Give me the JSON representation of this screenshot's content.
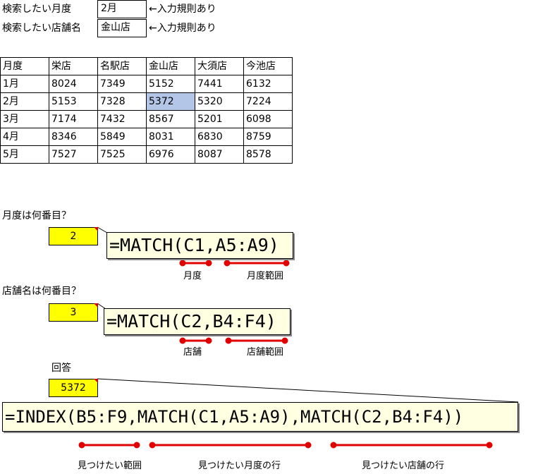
{
  "search": {
    "month_label": "検索したい月度",
    "month_value": "2月",
    "store_label": "検索したい店舗名",
    "store_value": "金山店",
    "rule_note": "←入力規則あり"
  },
  "table": {
    "headers": [
      "月度",
      "栄店",
      "名駅店",
      "金山店",
      "大須店",
      "今池店"
    ],
    "rows": [
      [
        "1月",
        "8024",
        "7349",
        "5152",
        "7441",
        "6132"
      ],
      [
        "2月",
        "5153",
        "7328",
        "5372",
        "5320",
        "7224"
      ],
      [
        "3月",
        "7174",
        "7432",
        "8567",
        "5201",
        "6098"
      ],
      [
        "4月",
        "8346",
        "5849",
        "8031",
        "6830",
        "8759"
      ],
      [
        "5月",
        "7527",
        "7525",
        "6976",
        "8087",
        "8578"
      ]
    ]
  },
  "month_section": {
    "question": "月度は何番目？",
    "result": "2",
    "formula": "=MATCH(C1,A5:A9)",
    "annot_left": "月度",
    "annot_right": "月度範囲"
  },
  "store_section": {
    "question": "店舗名は何番目？",
    "result": "3",
    "formula": "=MATCH(C2,B4:F4)",
    "annot_left": "店舗",
    "annot_right": "店舗範囲"
  },
  "answer_section": {
    "label": "回答",
    "result": "5372",
    "formula": "=INDEX(B5:F9,MATCH(C1,A5:A9),MATCH(C2,B4:F4))",
    "annot_1": "見つけたい範囲",
    "annot_2": "見つけたい月度の行",
    "annot_3": "見つけたい店舗の行"
  },
  "colors": {
    "highlight": "#b4c6e7",
    "result_fill": "#ffff00",
    "comment_fill": "#ffffe1",
    "marker": "#e00000"
  }
}
